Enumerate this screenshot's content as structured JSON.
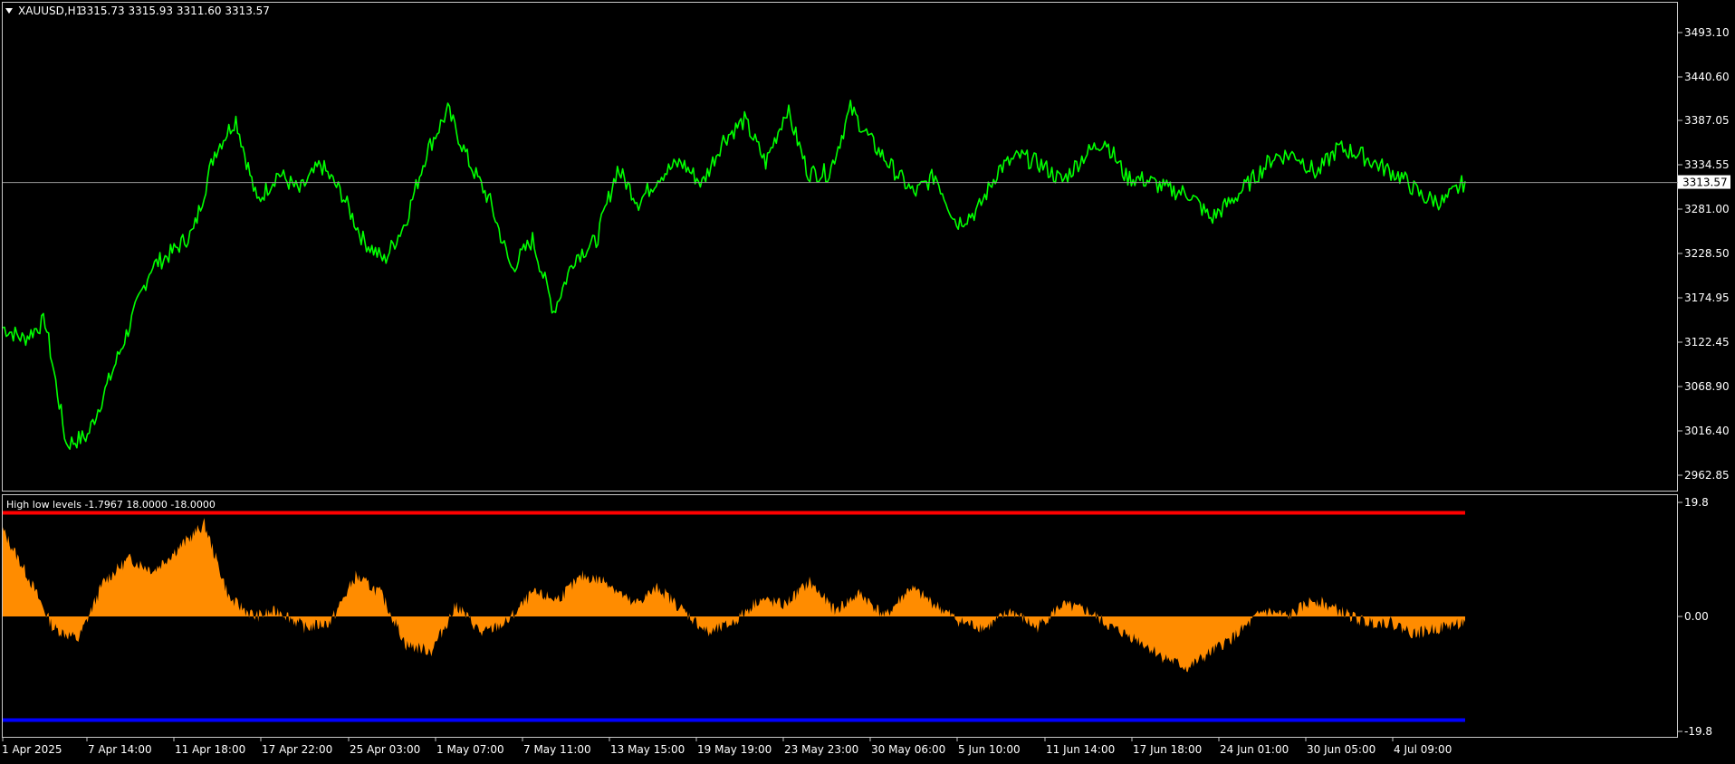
{
  "colors": {
    "background": "#000000",
    "frame": "#c8c8c8",
    "price_line": "#00ff00",
    "current_price_line": "#9a9a9a",
    "histogram": "#ff8c00",
    "high_level": "#ff0000",
    "low_level": "#0000ff",
    "text": "#ffffff"
  },
  "main_chart": {
    "symbol": "XAUUSD,H1",
    "ohlc": "3315.73 3315.93 3311.60 3313.57",
    "dropdown_icon": "triangle-down-icon",
    "current_price": 3313.57,
    "current_price_label": "3313.57",
    "y_axis_labels": [
      "3493.10",
      "3440.60",
      "3387.05",
      "3334.55",
      "3281.00",
      "3228.50",
      "3174.95",
      "3122.45",
      "3068.90",
      "3016.40",
      "2962.85"
    ]
  },
  "indicator": {
    "title": "High low levels -1.7967 18.0000 -18.0000",
    "high_level": 18,
    "low_level": -18,
    "y_axis_labels": [
      "19.8",
      "0.00",
      "-19.8"
    ]
  },
  "x_axis_labels": [
    "1 Apr 2025",
    "7 Apr 14:00",
    "11 Apr 18:00",
    "17 Apr 22:00",
    "25 Apr 03:00",
    "1 May 07:00",
    "7 May 11:00",
    "13 May 15:00",
    "19 May 19:00",
    "23 May 23:00",
    "30 May 06:00",
    "5 Jun 10:00",
    "11 Jun 14:00",
    "17 Jun 18:00",
    "24 Jun 01:00",
    "30 Jun 05:00",
    "4 Jul 09:00"
  ],
  "chart_data": [
    {
      "type": "line",
      "symbol": "XAUUSD,H1",
      "x": [
        "1 Apr 2025",
        "3 Apr",
        "5 Apr",
        "7 Apr 14:00",
        "9 Apr",
        "11 Apr 18:00",
        "14 Apr",
        "16 Apr",
        "17 Apr 22:00",
        "19 Apr",
        "22 Apr",
        "25 Apr 03:00",
        "28 Apr",
        "30 Apr",
        "1 May 07:00",
        "3 May",
        "5 May",
        "7 May 11:00",
        "9 May",
        "11 May",
        "13 May 15:00",
        "15 May",
        "17 May",
        "19 May 19:00",
        "21 May",
        "23 May 23:00",
        "26 May",
        "28 May",
        "30 May 06:00",
        "2 Jun",
        "5 Jun 10:00",
        "7 Jun",
        "9 Jun",
        "11 Jun 14:00",
        "13 Jun",
        "15 Jun",
        "17 Jun 18:00",
        "20 Jun",
        "22 Jun",
        "24 Jun 01:00",
        "26 Jun",
        "28 Jun",
        "30 Jun 05:00",
        "2 Jul",
        "4 Jul 09:00",
        "6 Jul",
        "8 Jul"
      ],
      "y": [
        3140,
        3126,
        3148,
        3000,
        3010,
        3075,
        3143,
        3212,
        3230,
        3255,
        3350,
        3390,
        3290,
        3325,
        3303,
        3335,
        3300,
        3245,
        3220,
        3266,
        3350,
        3400,
        3338,
        3290,
        3210,
        3245,
        3160,
        3225,
        3243,
        3330,
        3290,
        3322,
        3338,
        3312,
        3365,
        3388,
        3337,
        3402,
        3325,
        3325,
        3402,
        3362,
        3330,
        3300,
        3322,
        3265,
        3280,
        3330,
        3345,
        3335,
        3315,
        3345,
        3365,
        3320,
        3316,
        3305,
        3300,
        3270,
        3292,
        3318,
        3345,
        3347,
        3324,
        3355,
        3348,
        3333,
        3320,
        3296,
        3290,
        3315
      ],
      "ylim": [
        2950,
        3500
      ]
    },
    {
      "type": "bar",
      "name": "High low levels",
      "x": [
        "1 Apr 2025",
        "7 Apr 14:00",
        "11 Apr 18:00",
        "17 Apr 22:00",
        "25 Apr 03:00",
        "1 May 07:00",
        "7 May 11:00",
        "13 May 15:00",
        "19 May 19:00",
        "23 May 23:00",
        "30 May 06:00",
        "5 Jun 10:00",
        "11 Jun 14:00",
        "17 Jun 18:00",
        "24 Jun 01:00",
        "30 Jun 05:00",
        "4 Jul 09:00"
      ],
      "values": [
        15,
        7,
        -2,
        -4,
        6,
        10,
        8,
        12,
        16,
        3,
        0,
        1,
        -2,
        -1,
        7,
        4,
        -5,
        -6,
        2,
        -3,
        -1,
        4,
        3,
        7,
        6,
        2,
        5,
        1,
        -3,
        -1,
        3,
        2,
        6,
        1,
        4,
        0,
        5,
        2,
        -1,
        -2,
        1,
        -2,
        2,
        1,
        -2,
        -4,
        -7,
        -9,
        -6,
        -3,
        1,
        0,
        3,
        1,
        -1,
        -1,
        -3,
        -2,
        -1
      ],
      "levels": [
        18,
        -18
      ],
      "ylim": [
        -19.8,
        19.8
      ]
    }
  ]
}
